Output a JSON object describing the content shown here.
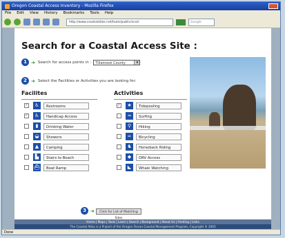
{
  "window": {
    "title": "Oregon Coastal Access Inventory - Mozilla Firefox"
  },
  "menu": [
    "File",
    "Edit",
    "View",
    "History",
    "Bookmarks",
    "Tools",
    "Help"
  ],
  "toolbar": {
    "address": "http://www.coastalatlas.net/tools/public/ocai/",
    "search_placeholder": "Google"
  },
  "page": {
    "title": "Search for a Coastal Access Site :",
    "step1_label": "Search for access points in :",
    "step1_select": "Tillamook County",
    "step2_label": "Select the Facilities or Activities you are looking for:",
    "facilities_header": "Facilites",
    "activities_header": "Activities",
    "facilities": [
      {
        "label": "Restrooms",
        "checked": true,
        "icon": "restroom-icon",
        "color": "#1c4fa8",
        "glyph": "♿"
      },
      {
        "label": "Handicap Access",
        "checked": true,
        "icon": "wheelchair-icon",
        "color": "#1c4fa8",
        "glyph": "♿"
      },
      {
        "label": "Drinking Water",
        "checked": false,
        "icon": "water-icon",
        "color": "#1c4fa8",
        "glyph": "▮"
      },
      {
        "label": "Showers",
        "checked": false,
        "icon": "shower-icon",
        "color": "#1c4fa8",
        "glyph": "◒"
      },
      {
        "label": "Camping",
        "checked": false,
        "icon": "tent-icon",
        "color": "#1c4fa8",
        "glyph": "▲"
      },
      {
        "label": "Stairs to Beach",
        "checked": false,
        "icon": "stairs-icon",
        "color": "#1c4fa8",
        "glyph": "▙"
      },
      {
        "label": "Boat Ramp",
        "checked": false,
        "icon": "boat-icon",
        "color": "#1c4fa8",
        "glyph": "⛴"
      }
    ],
    "activities": [
      {
        "label": "Tidepooling",
        "checked": true,
        "icon": "starfish-icon",
        "color": "#1c4fa8",
        "glyph": "★"
      },
      {
        "label": "Surfing",
        "checked": false,
        "icon": "surfing-icon",
        "color": "#1c4fa8",
        "glyph": "≈"
      },
      {
        "label": "Hiking",
        "checked": false,
        "icon": "hiking-icon",
        "color": "#1c4fa8",
        "glyph": "⚲"
      },
      {
        "label": "Bicycling",
        "checked": false,
        "icon": "bicycle-icon",
        "color": "#1c4fa8",
        "glyph": "∞"
      },
      {
        "label": "Horseback Riding",
        "checked": false,
        "icon": "horse-icon",
        "color": "#1c4fa8",
        "glyph": "♞"
      },
      {
        "label": "ORV Access",
        "checked": false,
        "icon": "orv-icon",
        "color": "#1c4fa8",
        "glyph": "◆"
      },
      {
        "label": "Whale Watching",
        "checked": false,
        "icon": "whale-icon",
        "color": "#1c4fa8",
        "glyph": "◣"
      }
    ],
    "submit_label": "Click for List of Matching Sites",
    "footer_nav": "Home | Maps | Tools | Learn | Search | Background | About Us | Feeding | Links",
    "footer_note": "The Coastal Atlas is a Project of the Oregon Ocean-Coastal Management Program, Copyright © 2005"
  },
  "status": "Done"
}
